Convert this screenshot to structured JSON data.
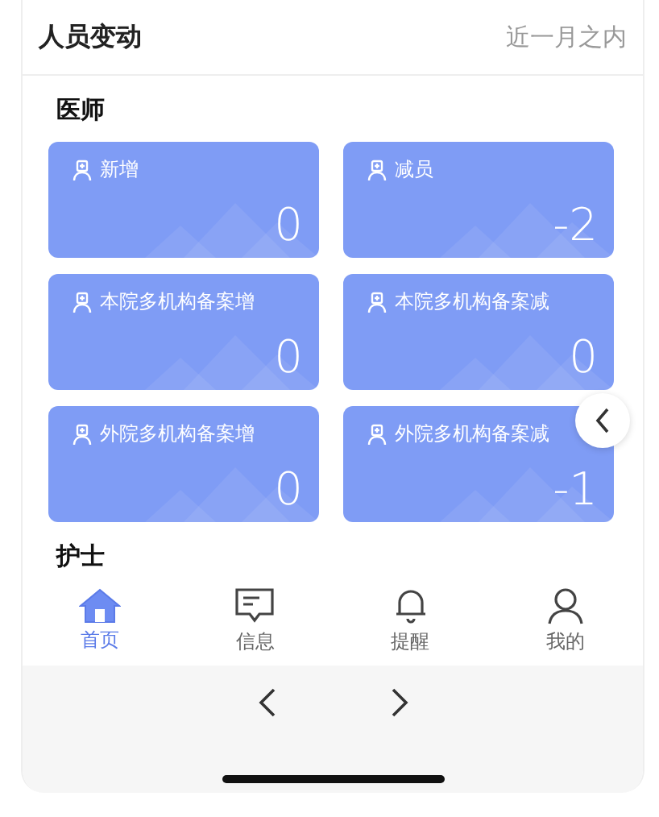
{
  "header": {
    "title": "人员变动",
    "range": "近一月之内"
  },
  "sections": [
    {
      "title": "医师",
      "cards": [
        {
          "label": "新增",
          "value": "0"
        },
        {
          "label": "减员",
          "value": "-2"
        },
        {
          "label": "本院多机构备案增",
          "value": "0"
        },
        {
          "label": "本院多机构备案减",
          "value": "0"
        },
        {
          "label": "外院多机构备案增",
          "value": "0"
        },
        {
          "label": "外院多机构备案减",
          "value": "-1"
        }
      ]
    },
    {
      "title": "护士"
    }
  ],
  "tabs": [
    {
      "label": "首页",
      "kind": "home",
      "selected": true
    },
    {
      "label": "信息",
      "kind": "message",
      "selected": false
    },
    {
      "label": "提醒",
      "kind": "bell",
      "selected": false
    },
    {
      "label": "我的",
      "kind": "person",
      "selected": false
    }
  ]
}
